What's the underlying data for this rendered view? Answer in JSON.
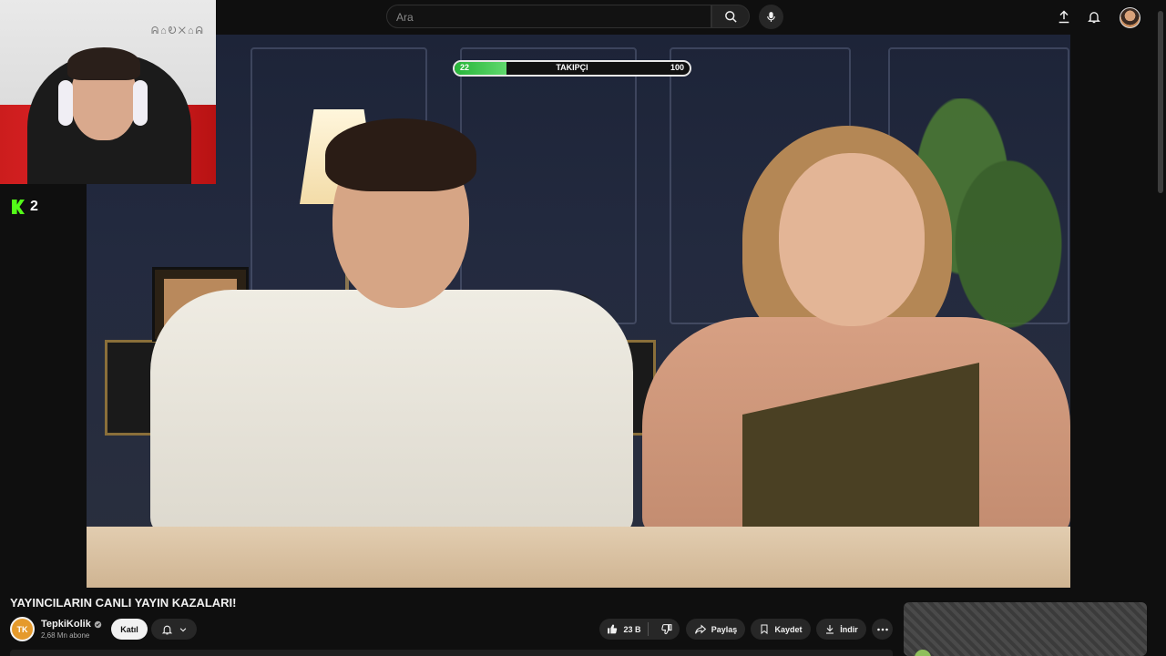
{
  "header": {
    "search_placeholder": "Ara"
  },
  "overlay": {
    "follower_goal": {
      "current": "22",
      "label": "TAKIPÇI",
      "target": "100",
      "progress_fraction": 0.22
    },
    "webcam_logo": "ᕱ⌂Ꭷ✕⌂ᕱ",
    "kick_viewers": "2"
  },
  "video": {
    "title": "YAYINCILARIN CANLI YAYIN KAZALARI!"
  },
  "channel": {
    "avatar_text": "TK",
    "name": "TepkiKolik",
    "subscribers": "2,68 Mn abone",
    "join_label": "Katıl"
  },
  "actions": {
    "likes": "23 B",
    "share_label": "Paylaş",
    "save_label": "Kaydet",
    "download_label": "İndir"
  },
  "colors": {
    "kick_green": "#53fc18",
    "progress_green": "#28b53a",
    "channel_avatar": "#e59a2c"
  }
}
